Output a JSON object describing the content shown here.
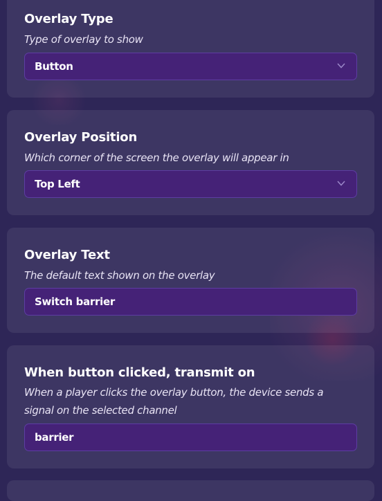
{
  "settings": [
    {
      "label": "Overlay Type",
      "description": "Type of overlay to show",
      "control": "dropdown",
      "value": "Button",
      "icon": "chevron-down-icon"
    },
    {
      "label": "Overlay Position",
      "description": "Which corner of the screen the overlay will appear in",
      "control": "dropdown",
      "value": "Top Left",
      "icon": "chevron-down-icon"
    },
    {
      "label": "Overlay Text",
      "description": "The default text shown on the overlay",
      "control": "text-input",
      "value": "Switch barrier"
    },
    {
      "label": "When button clicked, transmit on",
      "description_lines": [
        "When a player clicks the overlay button, the device sends a",
        "signal on the selected channel"
      ],
      "control": "text-input",
      "value": "barrier"
    }
  ],
  "colors": {
    "background": "#2e2657",
    "field": "#452277",
    "field_border": "#5e3da3",
    "text": "#ffffff"
  }
}
